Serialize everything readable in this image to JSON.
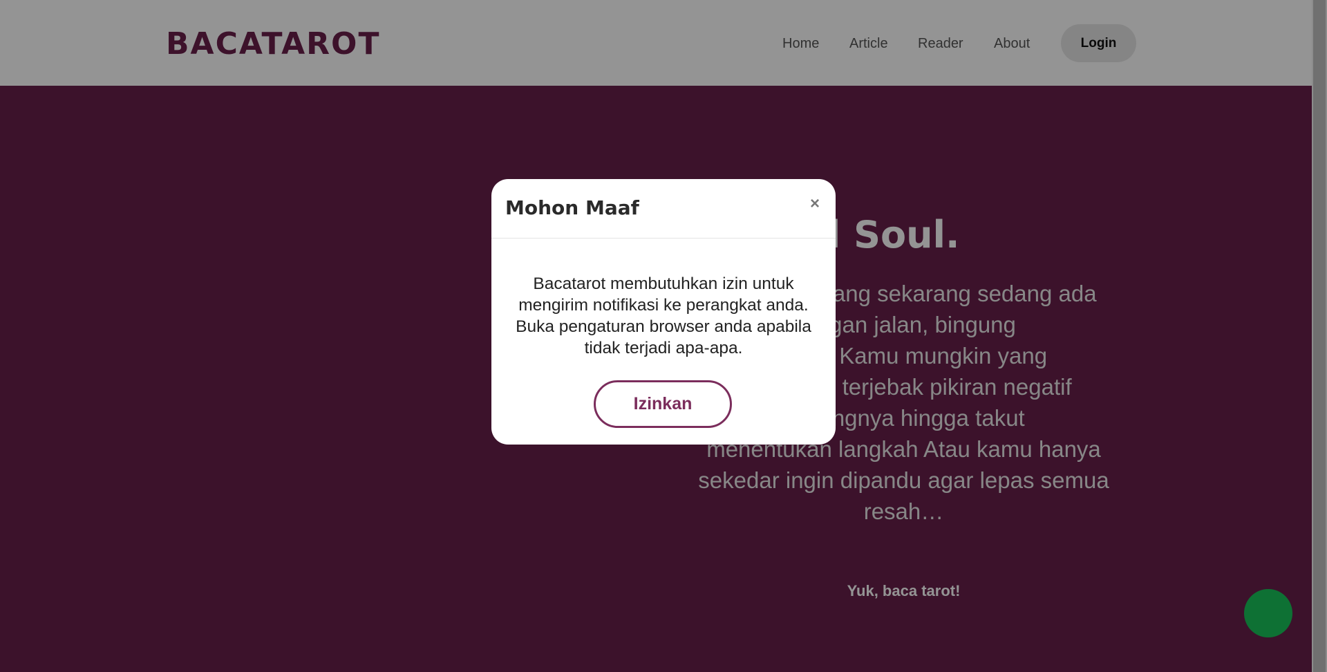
{
  "header": {
    "logo": "BACATAROT",
    "nav": [
      "Home",
      "Article",
      "Reader",
      "About"
    ],
    "login_label": "Login"
  },
  "hero": {
    "title": "eautiful Soul.",
    "description_lines": [
      "yang sekarang sedang ada",
      "pangan jalan, bingung",
      "arah. Kamu mungkin yang",
      "ang terjebak pikiran negatif",
      "a ujungnya hingga takut",
      "menentukan langkah Atau kamu hanya",
      "sekedar ingin dipandu agar lepas semua",
      "resah…"
    ],
    "cta": "Yuk, baca tarot!"
  },
  "modal": {
    "title": "Mohon Maaf",
    "close_label": "×",
    "body": "Bacatarot membutuhkan izin untuk mengirim notifikasi ke perangkat anda. Buka pengaturan browser anda apabila tidak terjadi apa-apa.",
    "allow_label": "Izinkan"
  },
  "colors": {
    "brand": "#681f4a",
    "accent": "#7b2d5c",
    "chat_button": "#19c35a"
  },
  "icons": {
    "chat_fab": "chat-icon"
  }
}
